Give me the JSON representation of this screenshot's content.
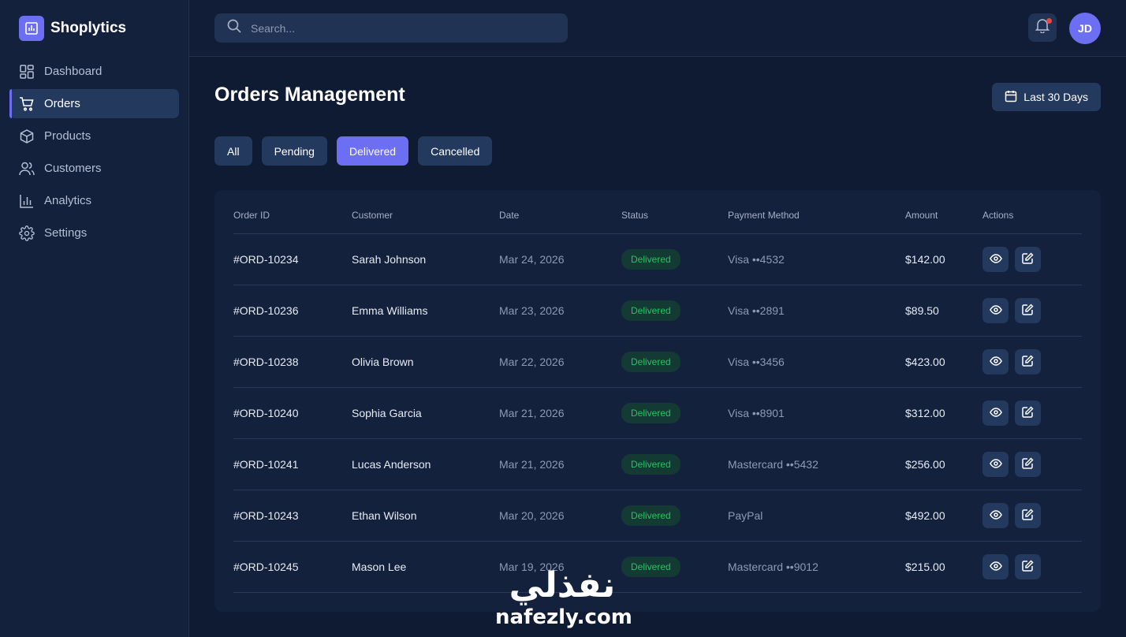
{
  "brand": {
    "name": "Shoplytics"
  },
  "sidebar": {
    "items": [
      {
        "label": "Dashboard",
        "icon": "dashboard-icon",
        "active": false
      },
      {
        "label": "Orders",
        "icon": "cart-icon",
        "active": true
      },
      {
        "label": "Products",
        "icon": "box-icon",
        "active": false
      },
      {
        "label": "Customers",
        "icon": "users-icon",
        "active": false
      },
      {
        "label": "Analytics",
        "icon": "chart-icon",
        "active": false
      },
      {
        "label": "Settings",
        "icon": "gear-icon",
        "active": false
      }
    ]
  },
  "topbar": {
    "search_placeholder": "Search...",
    "avatar_initials": "JD",
    "notification_dot_color": "#ef4444"
  },
  "page": {
    "title": "Orders Management",
    "date_range_label": "Last 30 Days"
  },
  "filters": [
    {
      "label": "All",
      "active": false
    },
    {
      "label": "Pending",
      "active": false
    },
    {
      "label": "Delivered",
      "active": true
    },
    {
      "label": "Cancelled",
      "active": false
    }
  ],
  "table": {
    "headers": [
      "Order ID",
      "Customer",
      "Date",
      "Status",
      "Payment Method",
      "Amount",
      "Actions"
    ],
    "rows": [
      {
        "id": "#ORD-10234",
        "customer": "Sarah Johnson",
        "date": "Mar 24, 2026",
        "status": "Delivered",
        "payment": "Visa ••4532",
        "amount": "$142.00"
      },
      {
        "id": "#ORD-10236",
        "customer": "Emma Williams",
        "date": "Mar 23, 2026",
        "status": "Delivered",
        "payment": "Visa ••2891",
        "amount": "$89.50"
      },
      {
        "id": "#ORD-10238",
        "customer": "Olivia Brown",
        "date": "Mar 22, 2026",
        "status": "Delivered",
        "payment": "Visa ••3456",
        "amount": "$423.00"
      },
      {
        "id": "#ORD-10240",
        "customer": "Sophia Garcia",
        "date": "Mar 21, 2026",
        "status": "Delivered",
        "payment": "Visa ••8901",
        "amount": "$312.00"
      },
      {
        "id": "#ORD-10241",
        "customer": "Lucas Anderson",
        "date": "Mar 21, 2026",
        "status": "Delivered",
        "payment": "Mastercard ••5432",
        "amount": "$256.00"
      },
      {
        "id": "#ORD-10243",
        "customer": "Ethan Wilson",
        "date": "Mar 20, 2026",
        "status": "Delivered",
        "payment": "PayPal",
        "amount": "$492.00"
      },
      {
        "id": "#ORD-10245",
        "customer": "Mason Lee",
        "date": "Mar 19, 2026",
        "status": "Delivered",
        "payment": "Mastercard ••9012",
        "amount": "$215.00"
      }
    ]
  },
  "watermark": {
    "arabic": "نفذلي",
    "latin": "nafezly.com"
  },
  "colors": {
    "accent": "#6c6ff2",
    "success": "#22c55e",
    "background": "#0f1a33"
  }
}
